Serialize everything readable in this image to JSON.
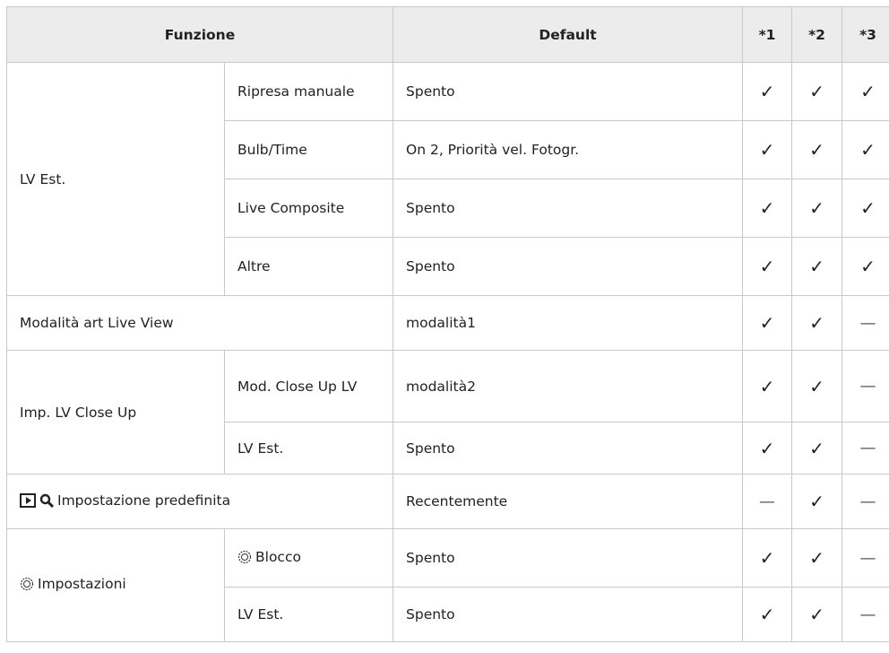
{
  "header": {
    "function": "Funzione",
    "default": "Default",
    "c1": "*1",
    "c2": "*2",
    "c3": "*3"
  },
  "marks": {
    "check": "✓",
    "dash": "—"
  },
  "groups": {
    "lv_est": "LV Est.",
    "art_live_view": "Modalità art Live View",
    "close_up": "Imp. LV Close Up",
    "playback": "Impostazione predefinita",
    "dial": "Impostazioni"
  },
  "rows": [
    {
      "sub": "Ripresa manuale",
      "default": "Spento"
    },
    {
      "sub": "Bulb/Time",
      "default": "On 2, Priorità vel. Fotogr."
    },
    {
      "sub": "Live Composite",
      "default": "Spento"
    },
    {
      "sub": "Altre",
      "default": "Spento"
    },
    {
      "sub": "",
      "default": "modalità1"
    },
    {
      "sub": "Mod. Close Up LV",
      "default": "modalità2"
    },
    {
      "sub": "LV Est.",
      "default": "Spento"
    },
    {
      "sub": "",
      "default": "Recentemente"
    },
    {
      "sub": "Blocco",
      "default": "Spento"
    },
    {
      "sub": "LV Est.",
      "default": "Spento"
    }
  ],
  "icons": [
    "playback-icon",
    "magnify-icon",
    "dial-icon"
  ]
}
